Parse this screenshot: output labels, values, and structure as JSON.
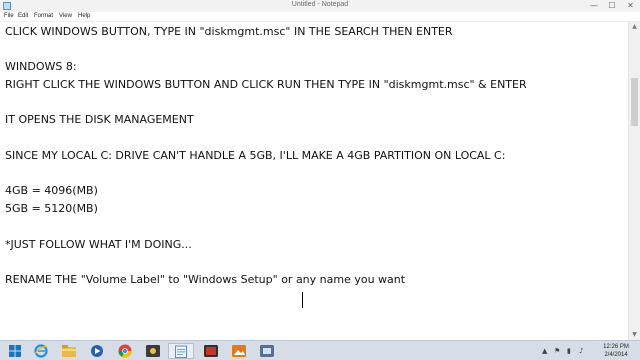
{
  "window": {
    "title": "Untitled - Notepad",
    "minimize_glyph": "—",
    "maximize_glyph": "☐",
    "close_glyph": "✕"
  },
  "menu": {
    "items": [
      "File",
      "Edit",
      "Format",
      "View",
      "Help"
    ]
  },
  "editor": {
    "lines": [
      "CLICK WINDOWS BUTTON, TYPE IN \"diskmgmt.msc\" IN THE SEARCH THEN ENTER",
      "WINDOWS 8:",
      "RIGHT CLICK THE WINDOWS BUTTON AND CLICK RUN THEN TYPE IN \"diskmgmt.msc\" & ENTER",
      "IT OPENS THE DISK MANAGEMENT",
      "SINCE MY LOCAL C: DRIVE CAN'T HANDLE A 5GB, I'LL MAKE A 4GB PARTITION ON LOCAL C:",
      "4GB = 4096(MB)",
      "5GB = 5120(MB)",
      "*JUST FOLLOW WHAT I'M DOING...",
      "RENAME THE \"Volume Label\" to \"Windows Setup\" or any name you want"
    ]
  },
  "scrollbar": {
    "up_glyph": "▲",
    "down_glyph": "▼"
  },
  "taskbar": {
    "apps": [
      {
        "icon": "windows-start-icon"
      },
      {
        "icon": "internet-explorer-icon"
      },
      {
        "icon": "file-explorer-icon"
      },
      {
        "icon": "windows-media-player-icon"
      },
      {
        "icon": "chrome-icon"
      },
      {
        "icon": "video-tool-icon"
      },
      {
        "icon": "notepad-icon",
        "active": true
      },
      {
        "icon": "media-app-icon"
      },
      {
        "icon": "image-app-icon"
      },
      {
        "icon": "setup-app-icon"
      }
    ],
    "tray": {
      "glyphs": [
        "▲",
        "⚑",
        "▮",
        "♪"
      ]
    },
    "clock": {
      "time": "12:26 PM",
      "date": "2/4/2014"
    }
  },
  "colors": {
    "taskbar_bg": "#d6dde6",
    "titlebar_bg": "#f2f2f2",
    "text": "#111111"
  }
}
